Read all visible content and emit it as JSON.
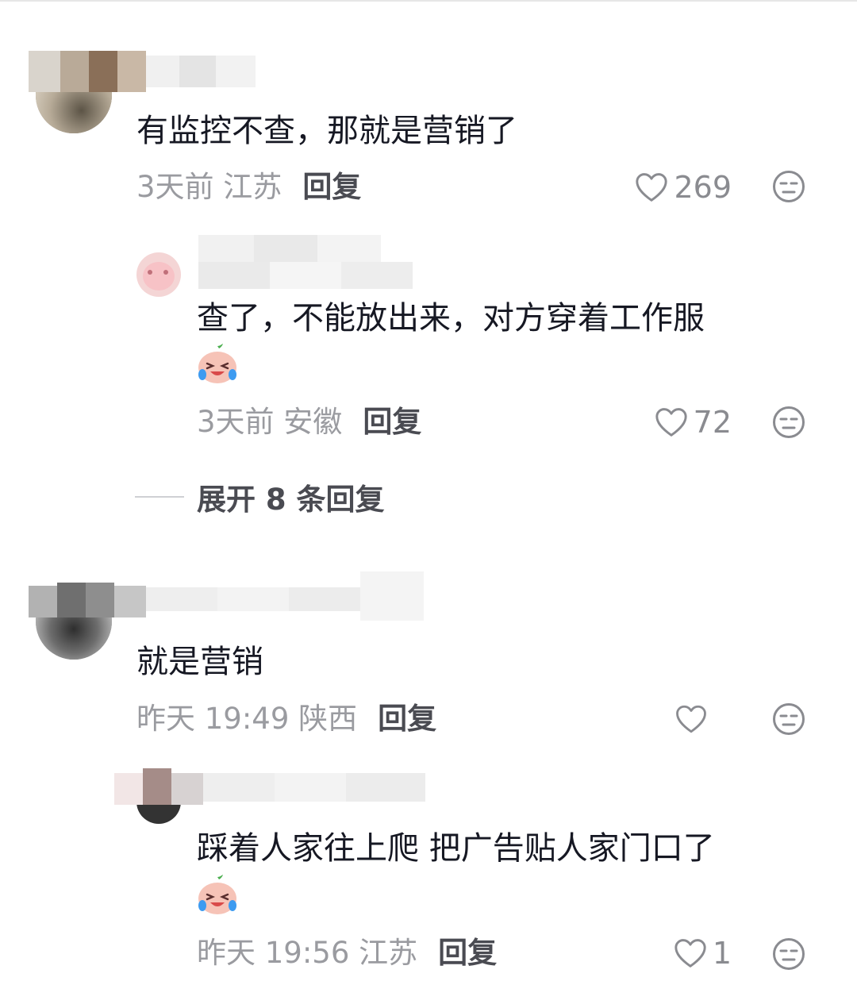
{
  "comments": [
    {
      "text": "有监控不查，那就是营销了",
      "time": "3天前 江苏",
      "reply_label": "回复",
      "likes": "269",
      "replies": [
        {
          "text": "查了，不能放出来，对方穿着工作服",
          "emoji": "crying-laughing-emoji",
          "time": "3天前 安徽",
          "reply_label": "回复",
          "likes": "72"
        }
      ],
      "expand_label": "展开 8 条回复"
    },
    {
      "text": "就是营销",
      "time": "昨天 19:49 陕西",
      "reply_label": "回复",
      "likes": "",
      "replies": [
        {
          "text": "踩着人家往上爬  把广告贴人家门口了",
          "emoji": "crying-laughing-emoji",
          "time": "昨天 19:56 江苏",
          "reply_label": "回复",
          "likes": "1"
        }
      ]
    }
  ],
  "icons": {
    "like": "heart-outline-icon",
    "dislike": "unamused-face-icon"
  },
  "colors": {
    "text": "#161823",
    "meta": "#9a9ba0",
    "reply": "#4a4b52",
    "icon": "#8a8b90"
  }
}
